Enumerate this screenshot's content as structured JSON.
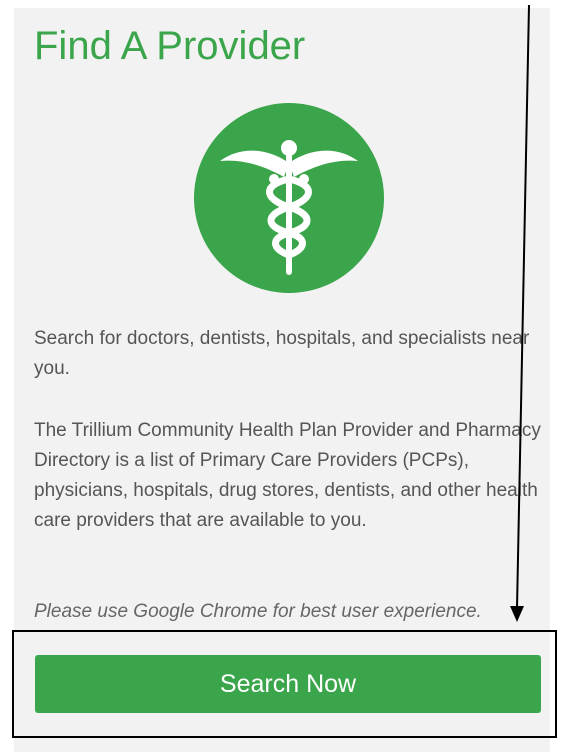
{
  "page": {
    "title": "Find A Provider",
    "paragraph_1": "Search for doctors, dentists, hospitals, and specialists near you.",
    "paragraph_2": "The Trillium Community Health Plan Provider and Pharmacy Directory is a list of Primary Care Providers (PCPs), physicians, hospitals, drug stores, dentists, and other health care providers that are available to you.",
    "browser_note": "Please use Google Chrome for best user experience."
  },
  "actions": {
    "search_label": "Search Now"
  },
  "icons": {
    "logo": "caduceus-icon",
    "annotation": "arrow-down-icon"
  },
  "colors": {
    "brand_green": "#3aa54a",
    "card_background": "#f2f2f2",
    "body_text": "#555555"
  }
}
